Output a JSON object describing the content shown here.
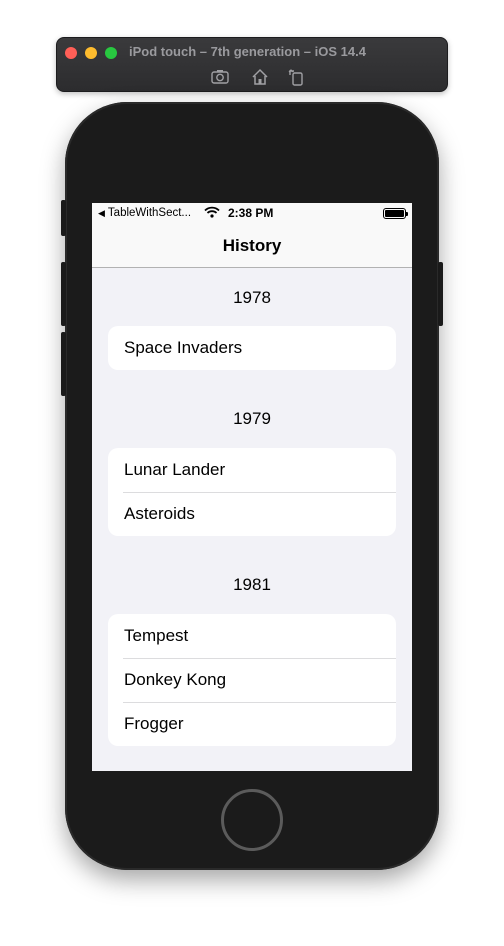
{
  "simulator": {
    "title": "iPod touch – 7th generation – iOS 14.4",
    "tools": [
      "screenshot-icon",
      "home-icon",
      "rotate-icon"
    ]
  },
  "statusbar": {
    "back_app": "TableWithSect...",
    "time": "2:38 PM"
  },
  "navbar": {
    "title": "History"
  },
  "sections": [
    {
      "header": "1978",
      "items": [
        "Space Invaders"
      ]
    },
    {
      "header": "1979",
      "items": [
        "Lunar Lander",
        "Asteroids"
      ]
    },
    {
      "header": "1981",
      "items": [
        "Tempest",
        "Donkey Kong",
        "Frogger"
      ]
    }
  ],
  "colors": {
    "background": "#f2f2f7",
    "cell": "#ffffff",
    "device": "#1b1b1b"
  }
}
